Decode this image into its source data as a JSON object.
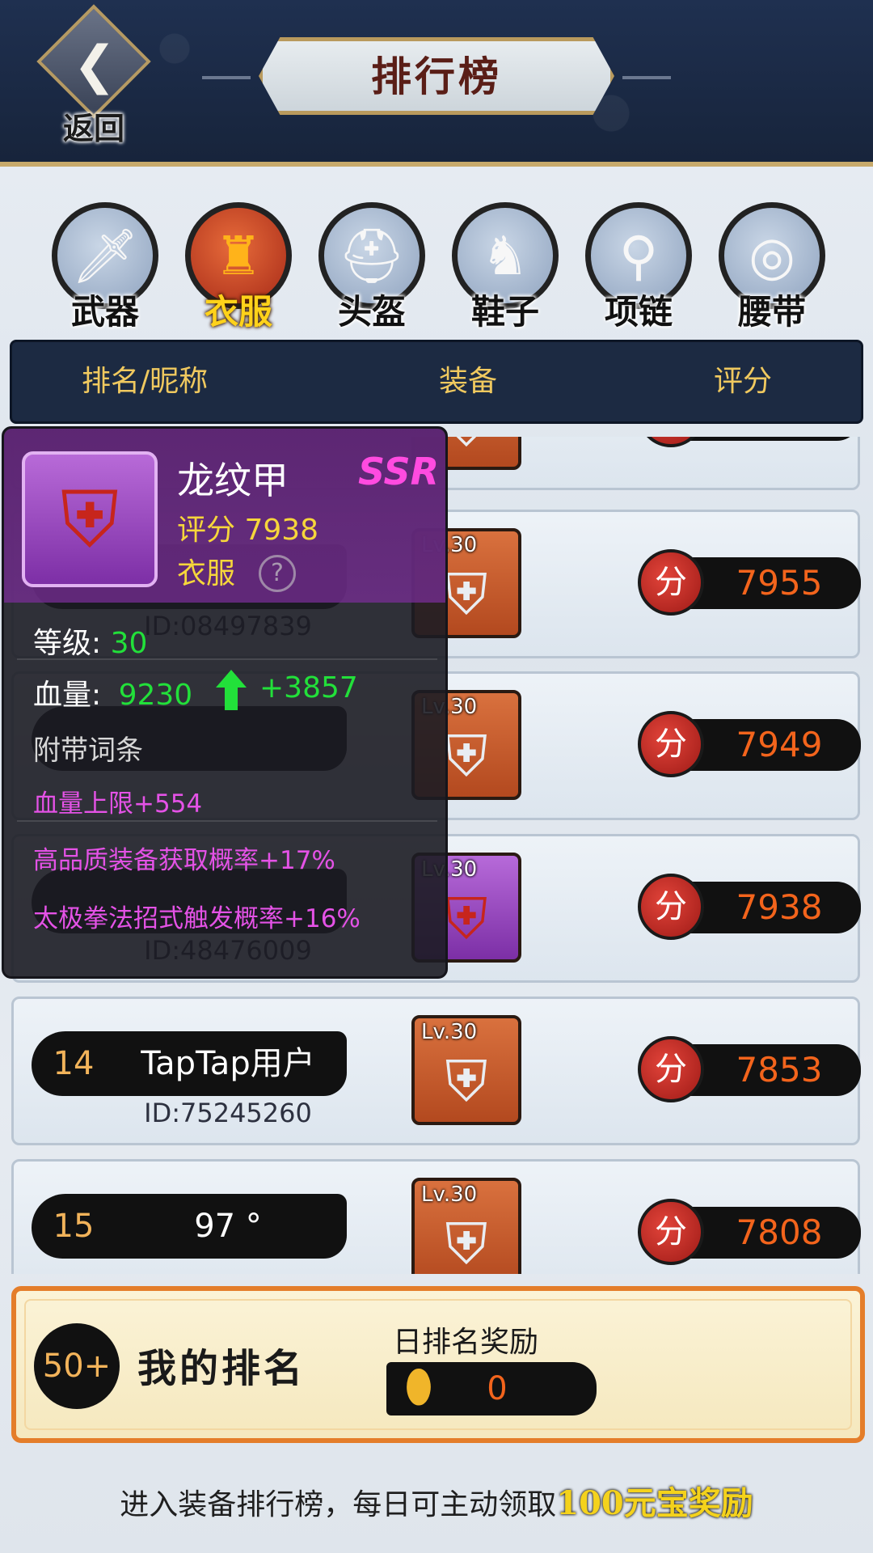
{
  "header": {
    "back_label": "返回",
    "title": "排行榜"
  },
  "tabs": [
    {
      "label": "武器",
      "icon": "weapon-icon",
      "active": false
    },
    {
      "label": "衣服",
      "icon": "armor-icon",
      "active": true
    },
    {
      "label": "头盔",
      "icon": "helmet-icon",
      "active": false
    },
    {
      "label": "鞋子",
      "icon": "boots-icon",
      "active": false
    },
    {
      "label": "项链",
      "icon": "necklace-icon",
      "active": false
    },
    {
      "label": "腰带",
      "icon": "belt-icon",
      "active": false
    }
  ],
  "columns": {
    "rank_name": "排名/昵称",
    "equipment": "装备",
    "score": "评分"
  },
  "rows": [
    {
      "rank": "",
      "name": "",
      "id": "",
      "level": "",
      "score_icon": "分",
      "score": ""
    },
    {
      "rank": "",
      "name": "",
      "id": "ID:08497839",
      "level": "Lv.30",
      "score_icon": "分",
      "score": "7955"
    },
    {
      "rank": "",
      "name": "",
      "id": "",
      "level": "Lv.30",
      "score_icon": "分",
      "score": "7949"
    },
    {
      "rank": "",
      "name": "",
      "id": "ID:48476009",
      "level": "Lv.30",
      "score_icon": "分",
      "score": "7938"
    },
    {
      "rank": "14",
      "name": "TapTap用户",
      "id": "ID:75245260",
      "level": "Lv.30",
      "score_icon": "分",
      "score": "7853"
    },
    {
      "rank": "15",
      "name": "97 °",
      "id": "",
      "level": "Lv.30",
      "score_icon": "分",
      "score": "7808"
    }
  ],
  "tooltip": {
    "item_name": "龙纹甲",
    "rarity": "SSR",
    "score_label": "评分 7938",
    "type": "衣服",
    "level_label": "等级:",
    "level_value": "30",
    "hp_label": "血量:",
    "hp_value": "9230",
    "hp_bonus": "+3857",
    "affix_title": "附带词条",
    "affixes": [
      "血量上限+554",
      "高品质装备获取概率+17%",
      "太极拳法招式触发概率+16%"
    ],
    "help": "?"
  },
  "my_rank": {
    "rank": "50+",
    "label": "我的排名",
    "reward_label": "日排名奖励",
    "reward_value": "0"
  },
  "footer": {
    "note": "进入装备排行榜，每日可主动领取",
    "highlight": "100元宝奖励"
  },
  "colors": {
    "header_bg": "#1b2a44",
    "accent_gold": "#f0c95f",
    "score_orange": "#f3641c",
    "ssr_pink": "#ff4be0",
    "stat_green": "#22e03a",
    "affix_magenta": "#e452e6"
  }
}
